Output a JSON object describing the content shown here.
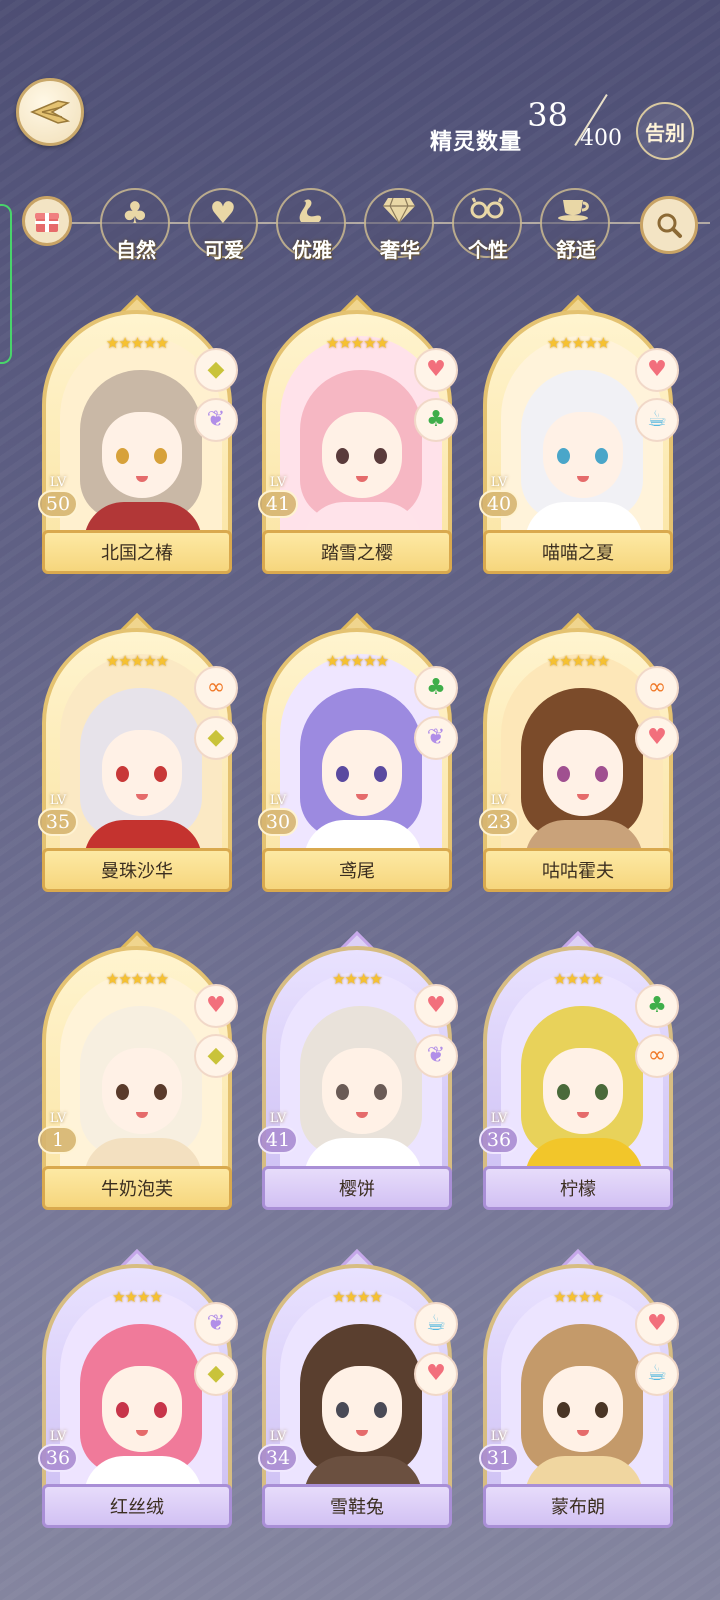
{
  "header": {
    "count_current": "38",
    "count_label": "精灵数量",
    "count_max": "400",
    "farewell_label": "告别"
  },
  "categories": [
    {
      "label": "自然",
      "icon": "clover-icon"
    },
    {
      "label": "可爱",
      "icon": "heart-icon"
    },
    {
      "label": "优雅",
      "icon": "swan-icon"
    },
    {
      "label": "奢华",
      "icon": "diamond-icon"
    },
    {
      "label": "个性",
      "icon": "glasses-icon"
    },
    {
      "label": "舒适",
      "icon": "teacup-icon"
    }
  ],
  "cards": [
    {
      "name": "北国之椿",
      "lv_text": "LV",
      "level": "50",
      "stars": "★★★★★",
      "badges": [
        "diamond",
        "swan"
      ]
    },
    {
      "name": "踏雪之樱",
      "lv_text": "LV",
      "level": "41",
      "stars": "★★★★★",
      "badges": [
        "heart",
        "clover"
      ]
    },
    {
      "name": "喵喵之夏",
      "lv_text": "LV",
      "level": "40",
      "stars": "★★★★★",
      "badges": [
        "heart",
        "teacup"
      ]
    },
    {
      "name": "曼珠沙华",
      "lv_text": "LV",
      "level": "35",
      "stars": "★★★★★",
      "badges": [
        "glasses",
        "diamond"
      ]
    },
    {
      "name": "鸢尾",
      "lv_text": "LV",
      "level": "30",
      "stars": "★★★★★",
      "badges": [
        "clover",
        "swan"
      ]
    },
    {
      "name": "咕咕霍夫",
      "lv_text": "LV",
      "level": "23",
      "stars": "★★★★★",
      "badges": [
        "glasses",
        "heart"
      ]
    },
    {
      "name": "牛奶泡芙",
      "lv_text": "LV",
      "level": "1",
      "stars": "★★★★★",
      "badges": [
        "heart",
        "diamond"
      ]
    },
    {
      "name": "樱饼",
      "lv_text": "LV",
      "level": "41",
      "stars": "★★★★",
      "badges": [
        "heart",
        "swan"
      ]
    },
    {
      "name": "柠檬",
      "lv_text": "LV",
      "level": "36",
      "stars": "★★★★",
      "badges": [
        "clover",
        "glasses"
      ]
    },
    {
      "name": "红丝绒",
      "lv_text": "LV",
      "level": "36",
      "stars": "★★★★",
      "badges": [
        "swan",
        "diamond"
      ]
    },
    {
      "name": "雪鞋兔",
      "lv_text": "LV",
      "level": "34",
      "stars": "★★★★",
      "badges": [
        "teacup",
        "heart"
      ]
    },
    {
      "name": "蒙布朗",
      "lv_text": "LV",
      "level": "31",
      "stars": "★★★★",
      "badges": [
        "heart",
        "teacup"
      ]
    }
  ],
  "colors": {
    "accent_gold": "#e4c271",
    "accent_purple": "#a98fd6",
    "nameplate_text": "#3b2e20"
  }
}
